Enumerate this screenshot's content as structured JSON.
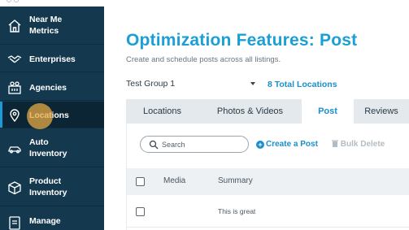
{
  "sidebar": {
    "items": [
      {
        "label_line1": "Near Me",
        "label_line2": "Metrics",
        "icon": "home-icon"
      },
      {
        "label_line1": "Enterprises",
        "label_line2": "",
        "icon": "handshake-icon"
      },
      {
        "label_line1": "Agencies",
        "label_line2": "",
        "icon": "agencies-icon"
      },
      {
        "label_line1": "Locations",
        "label_line2": "",
        "icon": "map-pin-icon",
        "active": true
      },
      {
        "label_line1": "Auto",
        "label_line2": "Inventory",
        "icon": "car-icon"
      },
      {
        "label_line1": "Product",
        "label_line2": "Inventory",
        "icon": "box-icon"
      },
      {
        "label_line1": "Manage",
        "label_line2": "",
        "icon": "manage-icon"
      }
    ]
  },
  "header": {
    "title_bold": "Optimization Features:",
    "title_light": "Post",
    "subtitle": "Create and schedule posts across all listings."
  },
  "group": {
    "selected": "Test Group 1",
    "total_locations": "8 Total Locations"
  },
  "tabs": [
    {
      "label": "Locations"
    },
    {
      "label": "Photos & Videos"
    },
    {
      "label": "Post",
      "active": true
    },
    {
      "label": "Reviews"
    }
  ],
  "toolbar": {
    "search_placeholder": "Search",
    "create_label": "Create a Post",
    "bulk_delete_label": "Bulk Delete"
  },
  "table": {
    "columns": [
      "Media",
      "Summary"
    ],
    "rows": [
      {
        "media": "",
        "summary": "This is great"
      }
    ]
  },
  "colors": {
    "sidebar_bg": "#14394f",
    "accent": "#1a9fd6",
    "cursor_highlight": "#e6aa46"
  }
}
